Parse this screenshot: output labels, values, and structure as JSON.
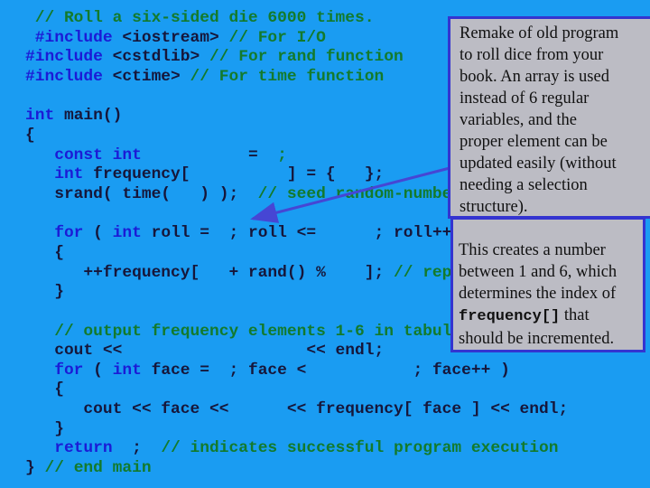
{
  "code_lines": [
    [
      [
        "cm",
        " // Roll a six-sided die 6000 times."
      ]
    ],
    [
      [
        "kw",
        " #include"
      ],
      [
        "tx",
        " <iostream>"
      ],
      [
        "cm",
        " // For I/O"
      ]
    ],
    [
      [
        "kw",
        "#include"
      ],
      [
        "tx",
        " <cstdlib>"
      ],
      [
        "cm",
        " // For rand function"
      ]
    ],
    [
      [
        "kw",
        "#include"
      ],
      [
        "tx",
        " <ctime>"
      ],
      [
        "cm",
        " // For time function"
      ]
    ],
    [],
    [
      [
        "kw",
        "int"
      ],
      [
        "tx",
        " main()"
      ]
    ],
    [
      [
        "tx",
        "{"
      ]
    ],
    [
      [
        "kw",
        "   const int"
      ],
      [
        "tx",
        "           =  "
      ],
      [
        "cm",
        ";"
      ]
    ],
    [
      [
        "kw",
        "   int"
      ],
      [
        "tx",
        " frequency[          ] = {   };"
      ]
    ],
    [
      [
        "tx",
        "   srand( time(   ) );  "
      ],
      [
        "cm",
        "// seed random-numbe"
      ]
    ],
    [],
    [
      [
        "kw",
        "   for"
      ],
      [
        "tx",
        " ( "
      ],
      [
        "kw",
        "int"
      ],
      [
        "tx",
        " roll =  ; roll <=      ; roll++"
      ]
    ],
    [
      [
        "tx",
        "   {"
      ]
    ],
    [
      [
        "tx",
        "      ++frequency[   + rand() %    ]; "
      ],
      [
        "cm",
        "// repl"
      ]
    ],
    [
      [
        "tx",
        "   }"
      ]
    ],
    [],
    [
      [
        "cm",
        "   // output frequency elements 1-6 in tabul"
      ]
    ],
    [
      [
        "tx",
        "   cout <<                   << endl;"
      ]
    ],
    [
      [
        "kw",
        "   for"
      ],
      [
        "tx",
        " ( "
      ],
      [
        "kw",
        "int"
      ],
      [
        "tx",
        " face =  ; face <           ; face++ )"
      ]
    ],
    [
      [
        "tx",
        "   {"
      ]
    ],
    [
      [
        "tx",
        "      cout << face <<      << frequency[ face ] << endl;"
      ]
    ],
    [
      [
        "tx",
        "   }"
      ]
    ],
    [
      [
        "kw",
        "   return"
      ],
      [
        "tx",
        "  ;  "
      ],
      [
        "cm",
        "// indicates successful program execution"
      ]
    ],
    [
      [
        "tx",
        "}"
      ],
      [
        "cm",
        " // end main"
      ]
    ]
  ],
  "callout_top": {
    "lines": [
      "Remake of old program",
      "to roll dice from your",
      "book. An array is used",
      "instead of 6 regular",
      "variables, and the",
      "proper element can be",
      "updated easily (without",
      "needing a selection",
      "structure)."
    ]
  },
  "callout_bottom": {
    "line1": "This creates a number",
    "line2": "between 1 and 6, which",
    "line3": "determines the index of",
    "code": "frequency[]",
    "line4_rest": " that",
    "line5": "should be incremented."
  },
  "colors": {
    "background": "#1a9cf2",
    "keyword": "#1b1bd6",
    "comment": "#137a2c",
    "callout": "#bcbcc4",
    "border": "#3434d0"
  }
}
